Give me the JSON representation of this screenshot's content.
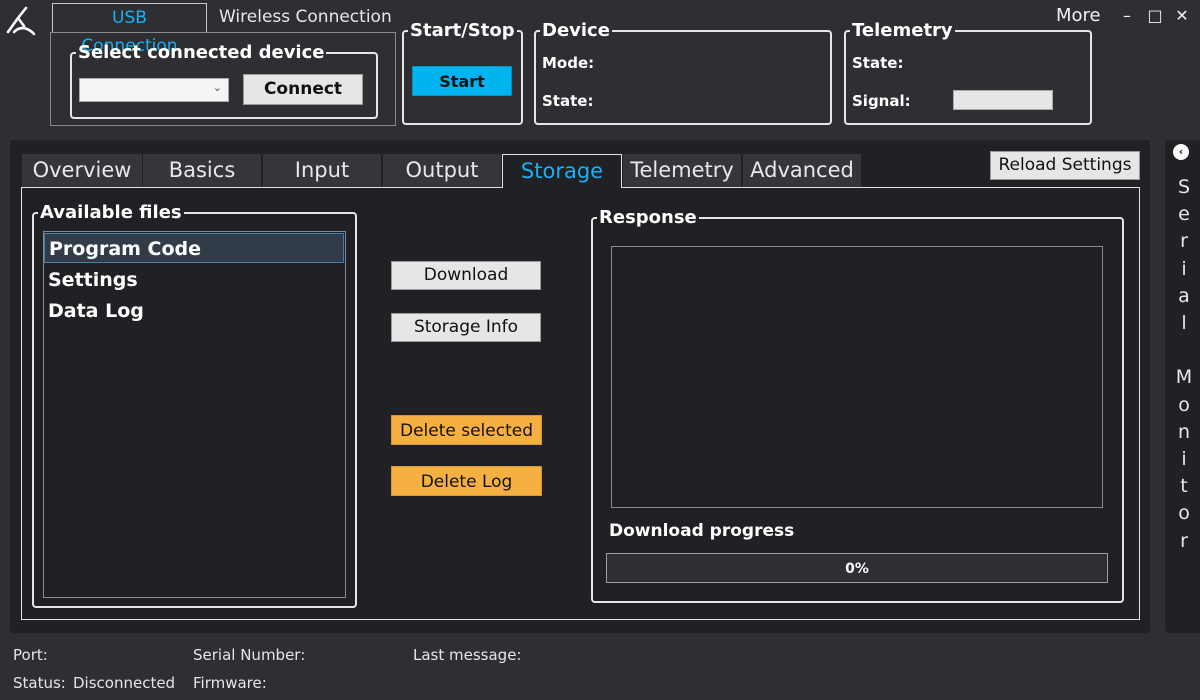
{
  "connection_tabs": {
    "usb": "USB Connection",
    "wireless": "Wireless Connection"
  },
  "select_device": {
    "legend": "Select connected device",
    "value": "",
    "connect_label": "Connect"
  },
  "start_stop": {
    "legend": "Start/Stop",
    "start_label": "Start"
  },
  "device": {
    "legend": "Device",
    "mode_label": "Mode:",
    "state_label": "State:"
  },
  "telemetry": {
    "legend": "Telemetry",
    "state_label": "State:",
    "signal_label": "Signal:"
  },
  "window": {
    "more": "More",
    "minimize": "–",
    "maximize": "□",
    "close": "✕"
  },
  "tabs": [
    "Overview",
    "Basics",
    "Input",
    "Output",
    "Storage",
    "Telemetry",
    "Advanced"
  ],
  "active_tab": "Storage",
  "reload_settings": "Reload Settings",
  "available_files": {
    "legend": "Available files",
    "items": [
      "Program Code",
      "Settings",
      "Data Log"
    ],
    "selected": "Program Code"
  },
  "actions": {
    "download": "Download",
    "storage_info": "Storage Info",
    "delete_selected": "Delete selected",
    "delete_log": "Delete Log"
  },
  "response": {
    "legend": "Response",
    "progress_label": "Download progress",
    "progress_text": "0%",
    "progress_value": 0
  },
  "serial_monitor": {
    "label": "Serial Monitor"
  },
  "status_bar": {
    "port_label": "Port:",
    "port_value": "",
    "status_label": "Status:",
    "status_value": "Disconnected",
    "serial_label": "Serial Number:",
    "firmware_label": "Firmware:",
    "last_message_label": "Last message:"
  },
  "colors": {
    "background": "#2d2f33",
    "panel": "#202124",
    "accent_blue": "#1cb0f6",
    "start_button": "#00b4f0",
    "warning_button": "#f5b041"
  }
}
